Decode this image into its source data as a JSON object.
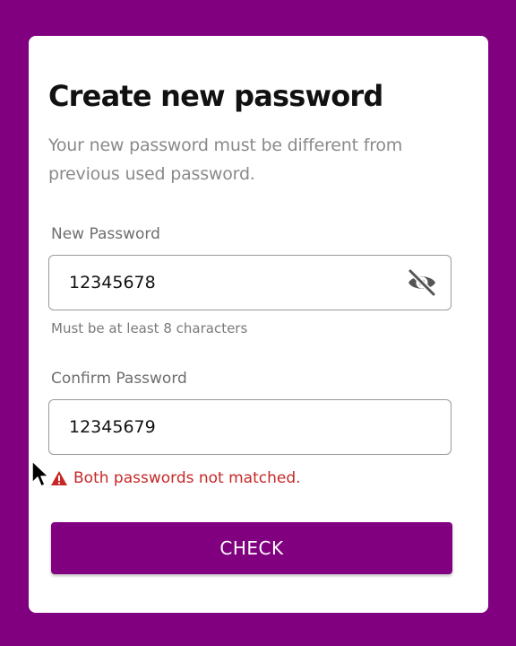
{
  "colors": {
    "background": "#800080",
    "card": "#ffffff",
    "button": "#800080",
    "error": "#c62828"
  },
  "header": {
    "title": "Create new password",
    "subtitle": "Your new password must be different from previous used password."
  },
  "new_password": {
    "label": "New Password",
    "value": "12345678",
    "toggle_icon": "eye-off-icon",
    "helper": "Must be at least 8 characters"
  },
  "confirm_password": {
    "label": "Confirm Password",
    "value": "12345679"
  },
  "error": {
    "icon": "warning-icon",
    "message": "Both passwords not matched."
  },
  "button": {
    "label": "CHECK"
  }
}
